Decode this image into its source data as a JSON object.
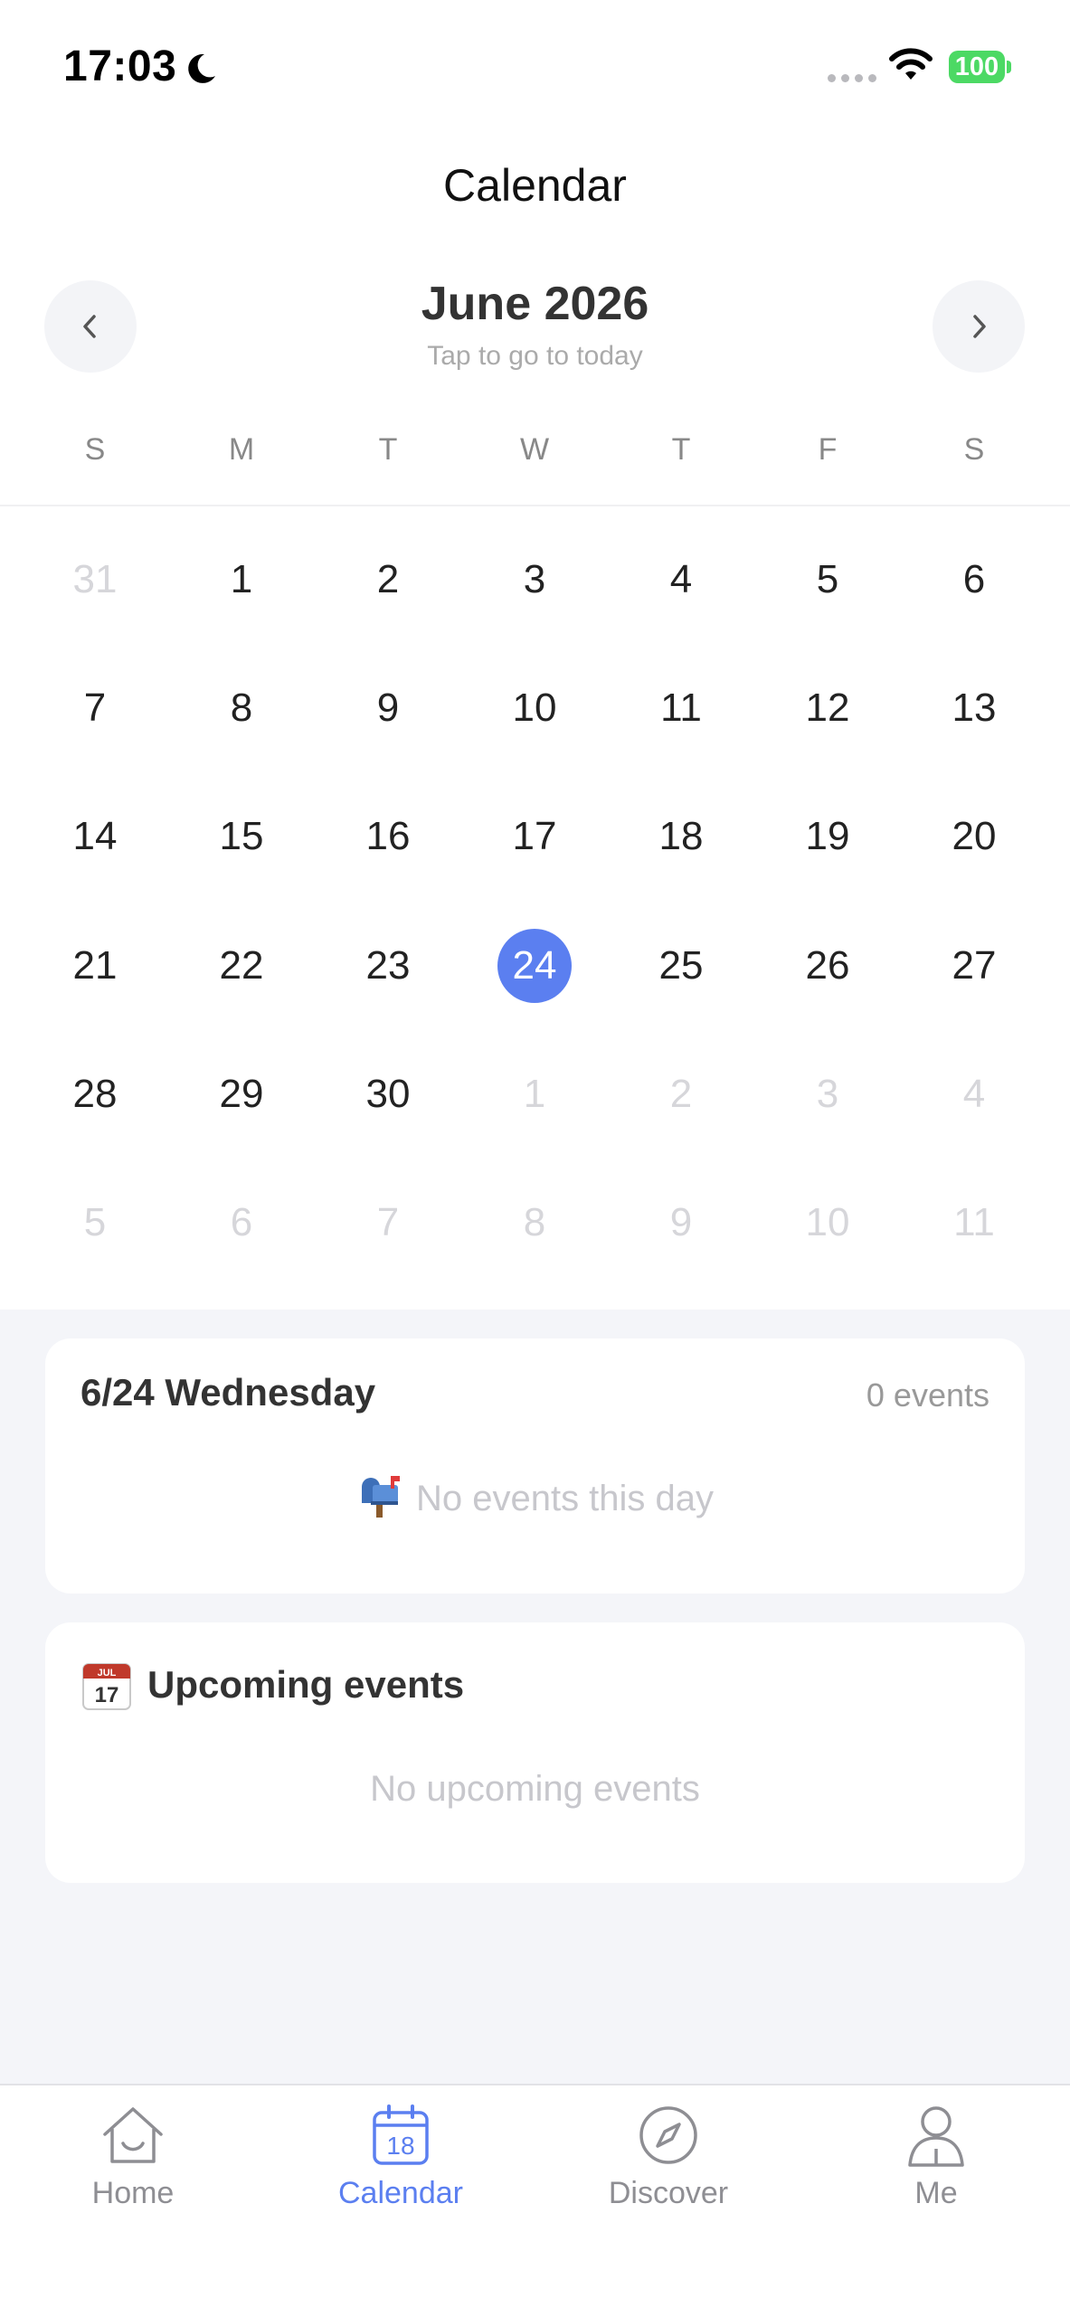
{
  "status_bar": {
    "time": "17:03",
    "battery": "100"
  },
  "header": {
    "title": "Calendar"
  },
  "month_nav": {
    "prev": "‹",
    "next": "›",
    "month_label": "June 2026",
    "subtitle": "Tap to go to today"
  },
  "weekdays": [
    "S",
    "M",
    "T",
    "W",
    "T",
    "F",
    "S"
  ],
  "calendar": {
    "weeks": [
      [
        {
          "d": "31",
          "o": true
        },
        {
          "d": "1"
        },
        {
          "d": "2"
        },
        {
          "d": "3"
        },
        {
          "d": "4"
        },
        {
          "d": "5"
        },
        {
          "d": "6"
        }
      ],
      [
        {
          "d": "7"
        },
        {
          "d": "8"
        },
        {
          "d": "9"
        },
        {
          "d": "10"
        },
        {
          "d": "11"
        },
        {
          "d": "12"
        },
        {
          "d": "13"
        }
      ],
      [
        {
          "d": "14"
        },
        {
          "d": "15"
        },
        {
          "d": "16"
        },
        {
          "d": "17"
        },
        {
          "d": "18"
        },
        {
          "d": "19"
        },
        {
          "d": "20"
        }
      ],
      [
        {
          "d": "21"
        },
        {
          "d": "22"
        },
        {
          "d": "23"
        },
        {
          "d": "24",
          "sel": true
        },
        {
          "d": "25"
        },
        {
          "d": "26"
        },
        {
          "d": "27"
        }
      ],
      [
        {
          "d": "28"
        },
        {
          "d": "29"
        },
        {
          "d": "30"
        },
        {
          "d": "1",
          "o": true
        },
        {
          "d": "2",
          "o": true
        },
        {
          "d": "3",
          "o": true
        },
        {
          "d": "4",
          "o": true
        }
      ],
      [
        {
          "d": "5",
          "o": true
        },
        {
          "d": "6",
          "o": true
        },
        {
          "d": "7",
          "o": true
        },
        {
          "d": "8",
          "o": true
        },
        {
          "d": "9",
          "o": true
        },
        {
          "d": "10",
          "o": true
        },
        {
          "d": "11",
          "o": true
        }
      ]
    ],
    "selected_color": "#5b7ff0"
  },
  "day_card": {
    "title": "6/24 Wednesday",
    "count": "0 events",
    "empty_text": "No events this day",
    "icon": "mailbox-icon"
  },
  "upcoming_card": {
    "title": "Upcoming events",
    "empty_text": "No upcoming events",
    "icon": "calendar-emoji-icon",
    "icon_text": "JUL 17"
  },
  "tabbar": {
    "items": [
      {
        "label": "Home",
        "icon": "home-icon",
        "active": false
      },
      {
        "label": "Calendar",
        "icon": "calendar-tab-icon",
        "active": true
      },
      {
        "label": "Discover",
        "icon": "compass-icon",
        "active": false
      },
      {
        "label": "Me",
        "icon": "person-icon",
        "active": false
      }
    ],
    "calendar_icon_number": "18",
    "accent": "#5b7ff0"
  }
}
